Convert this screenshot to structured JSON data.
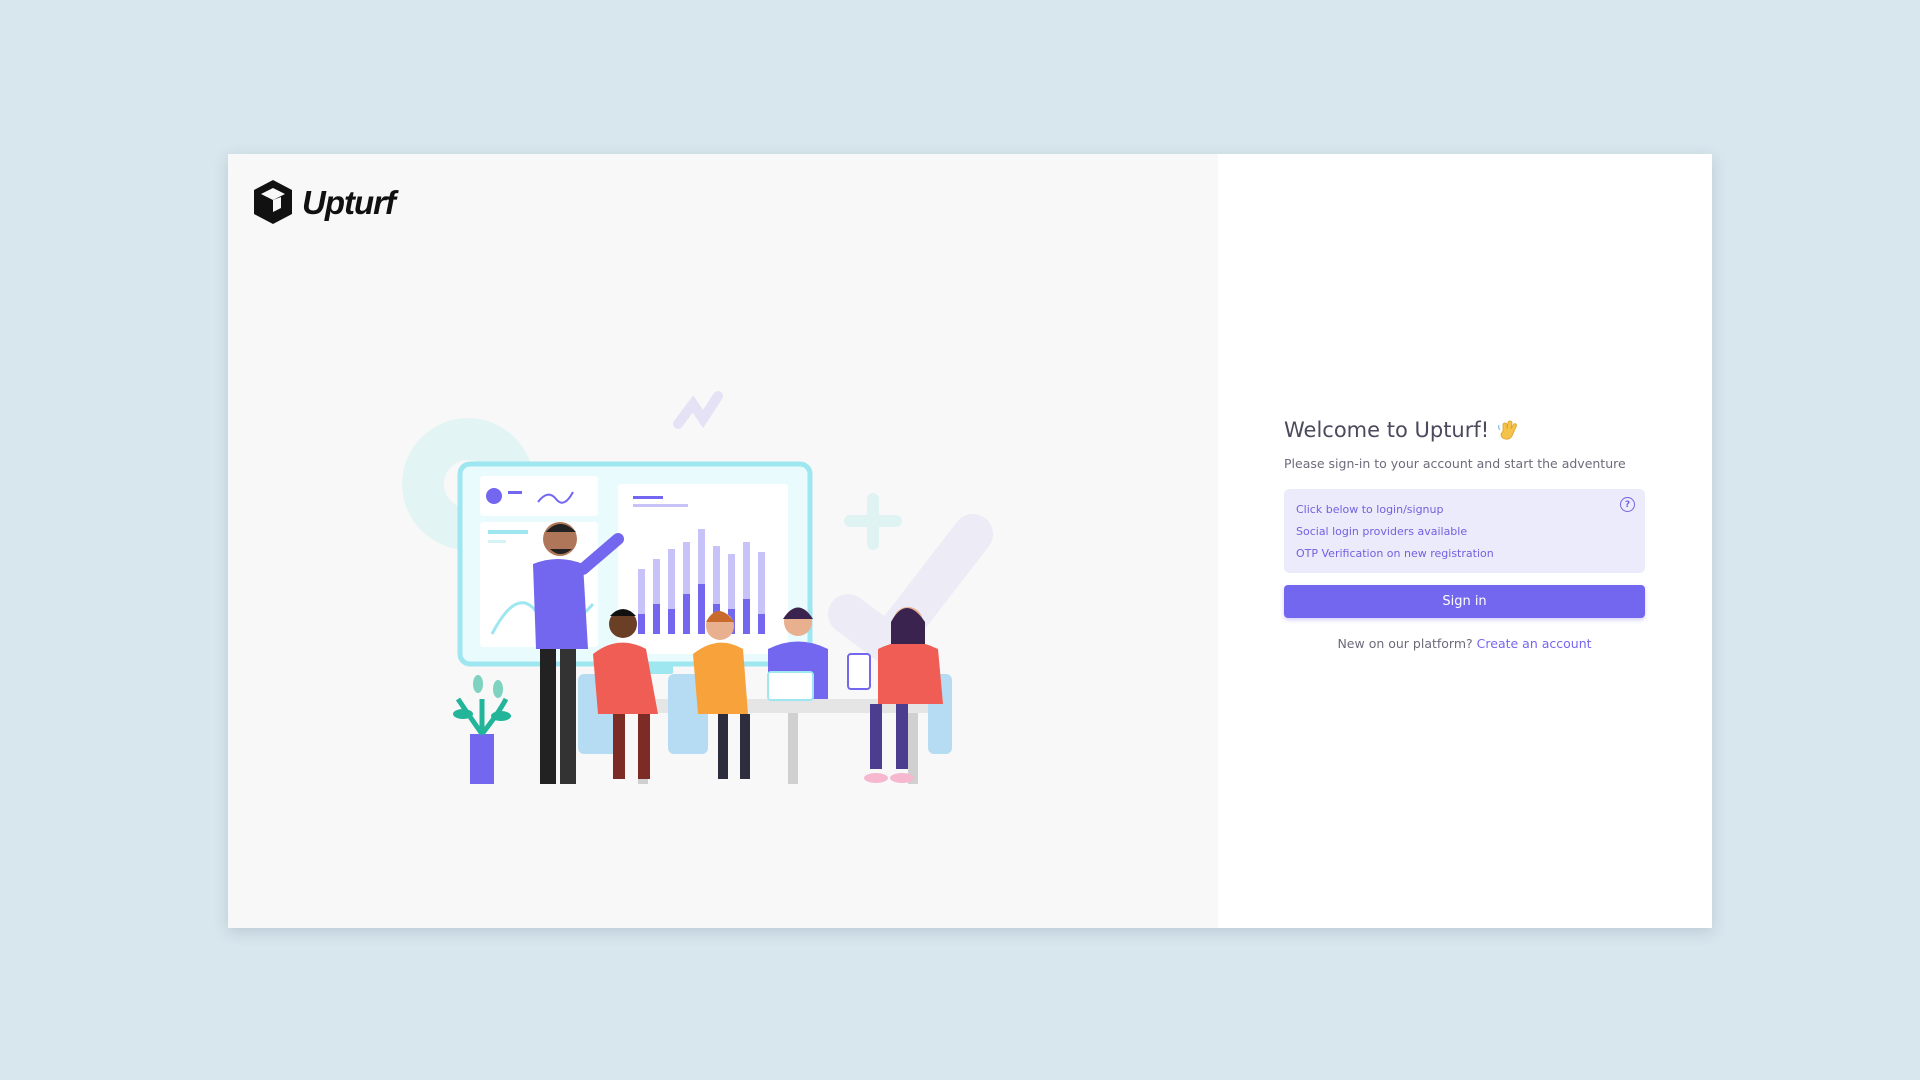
{
  "brand": {
    "name": "Upturf"
  },
  "auth": {
    "title": "Welcome to Upturf!",
    "title_icon": "waving-hand-icon",
    "subtitle": "Please sign-in to your account and start the adventure",
    "info_lines": [
      "Click below to login/signup",
      "Social login providers available",
      "OTP Verification on new registration"
    ],
    "help_icon": "help-circle-icon",
    "help_glyph": "?",
    "signin_label": "Sign in",
    "signup_prompt": "New on our platform?",
    "signup_link": "Create an account"
  },
  "illustration": {
    "subject": "team-meeting-illustration"
  },
  "colors": {
    "background": "#d8e6ee",
    "accent": "#7367f0",
    "info_bg": "#ecebfc",
    "left_panel": "#f8f8f8"
  }
}
